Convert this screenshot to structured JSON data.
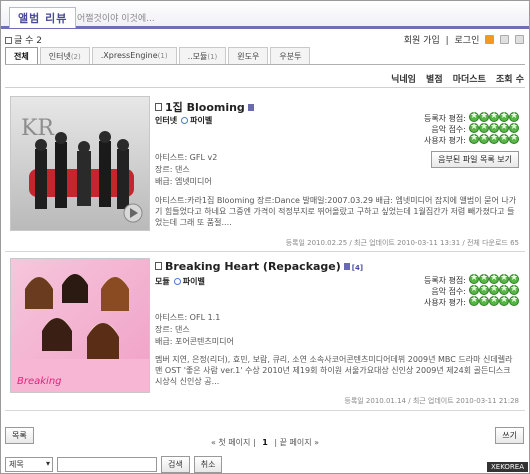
{
  "header": {
    "title": "앨범 리뷰",
    "subtitle": "어쩔것이야 이것에..."
  },
  "info": {
    "count_label": "글 수 2"
  },
  "toplinks": {
    "signup": "회원 가입",
    "login": "로그인"
  },
  "tabs": [
    {
      "label": "전체",
      "count": ""
    },
    {
      "label": "인터넷",
      "count": "(2)"
    },
    {
      "label": ".XpressEngine",
      "count": "(1)"
    },
    {
      "label": "..모듈",
      "count": "(1)"
    },
    {
      "label": "윈도우",
      "count": ""
    },
    {
      "label": "우분투",
      "count": ""
    }
  ],
  "sort": {
    "nick": "닉네임",
    "star": "별점",
    "title": "마더스트",
    "views": "조회 수"
  },
  "reviews": [
    {
      "name": "1집 Blooming",
      "category": "인터넷",
      "badge": "파이벨",
      "artist": "아티스트: GFL v2",
      "genre": "장르: 댄스",
      "label": "배급: 엠넷미디어",
      "desc": "아티스트:카라1집 Blooming 장르:Dance 발매일:2007.03.29 배급: 엠넷미디어 잡지에 앨범이 묻어 나가기 힘들었다고 하네요 그중엔 가격이 적정부지로 뛰어올랐고 구하고 싶었는데 1월집간가 저렴 빼가졌다고 들었는데 그래 또 품절....",
      "ratings": [
        {
          "label": "등록자 평점:",
          "stars": 5
        },
        {
          "label": "음악 점수:",
          "stars": 5
        },
        {
          "label": "사용자 평가:",
          "stars": 5
        }
      ],
      "button": "음부된 파일 목록 보기",
      "footer": "등록일 2010.02.25 / 최근 업데이트 2010-03-11 13:31 / 전체 다운로드 65"
    },
    {
      "name": "Breaking Heart (Repackage)",
      "category": "모듈",
      "badge": "파이벨",
      "extra": "[4]",
      "artist": "아티스트: OFL 1.1",
      "genre": "장르: 댄스",
      "label": "배급: 포어콘텐츠미디어",
      "desc": "멤버 지연, 은정(리더), 효민, 보람, 큐리, 소연 소속사코어콘텐츠미디어데뷔 2009년 MBC 드라마 신데렐라맨 OST '좋은 사람 ver.1' 수상 2010년 제19회 하이원 서울가요대상 신인상 2009년 제24회 골든디스크 시상식 신인상 공...",
      "ratings": [
        {
          "label": "등록자 평점:",
          "stars": 5
        },
        {
          "label": "음악 점수:",
          "stars": 5
        },
        {
          "label": "사용자 평가:",
          "stars": 5
        }
      ],
      "footer": "등록일 2010.01.14 / 최근 업데이트 2010-03-11 21:28"
    }
  ],
  "footer": {
    "list_btn": "목록",
    "write_btn": "쓰기",
    "first": "« 첫 페이지",
    "current": "1",
    "last": "끝 페이지 »",
    "search_select": "제목",
    "search_btn": "검색",
    "cancel_btn": "취소",
    "brand": "XEKOREA"
  },
  "colors": {
    "accent": "#6d6db8",
    "star": "#58b548"
  }
}
